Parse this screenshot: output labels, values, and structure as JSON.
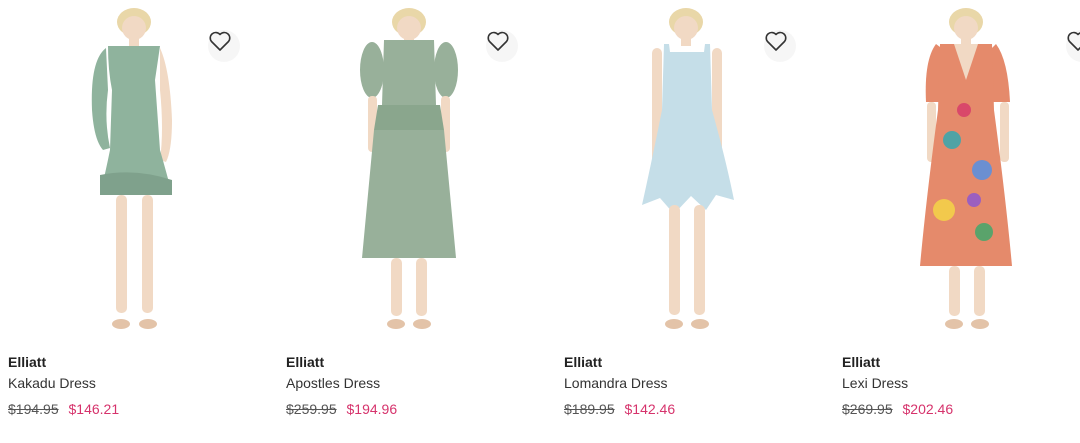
{
  "products": [
    {
      "brand": "Elliatt",
      "name": "Kakadu Dress",
      "original_price": "$194.95",
      "sale_price": "$146.21",
      "dress_color": "#8fb39d"
    },
    {
      "brand": "Elliatt",
      "name": "Apostles Dress",
      "original_price": "$259.95",
      "sale_price": "$194.96",
      "dress_color": "#98b09a"
    },
    {
      "brand": "Elliatt",
      "name": "Lomandra Dress",
      "original_price": "$189.95",
      "sale_price": "$142.46",
      "dress_color": "#c5dee8"
    },
    {
      "brand": "Elliatt",
      "name": "Lexi Dress",
      "original_price": "$269.95",
      "sale_price": "$202.46",
      "dress_color": "#e58a6b"
    }
  ],
  "colors": {
    "sale": "#d6336c",
    "text": "#222222",
    "strikethrough": "#555555"
  },
  "icons": {
    "wishlist": "heart-outline-icon"
  }
}
